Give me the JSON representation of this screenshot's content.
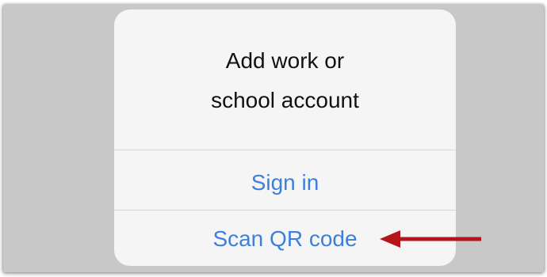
{
  "dialog": {
    "title": "Add work or\nschool account",
    "actions": [
      {
        "label": "Sign in"
      },
      {
        "label": "Scan QR code"
      }
    ]
  },
  "colors": {
    "backdrop": "#c8c8c8",
    "dialog_bg": "#f5f5f5",
    "action_text": "#3d7fdc",
    "arrow": "#b3151b"
  },
  "annotation": {
    "icon": "arrow-left-icon"
  }
}
